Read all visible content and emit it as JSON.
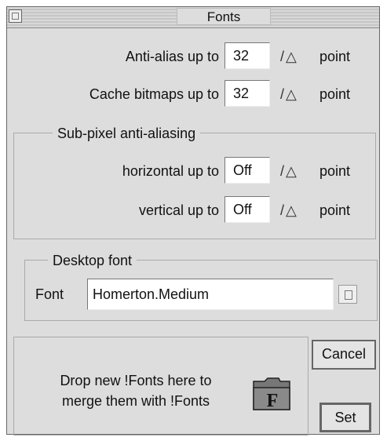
{
  "window": {
    "title": "Fonts"
  },
  "antialias": {
    "label": "Anti-alias up to",
    "value": "32",
    "unit": "point"
  },
  "cache": {
    "label": "Cache bitmaps up to",
    "value": "32",
    "unit": "point"
  },
  "subpixel": {
    "group_label": "Sub-pixel anti-aliasing",
    "horizontal": {
      "label": "horizontal up to",
      "value": "Off",
      "unit": "point"
    },
    "vertical": {
      "label": "vertical up to",
      "value": "Off",
      "unit": "point"
    }
  },
  "desktop_font": {
    "group_label": "Desktop font",
    "field_label": "Font",
    "value": "Homerton.Medium"
  },
  "drop": {
    "text_line1": "Drop new !Fonts here to",
    "text_line2": "merge them with !Fonts",
    "icon_letter": "F"
  },
  "buttons": {
    "cancel": "Cancel",
    "set": "Set"
  }
}
